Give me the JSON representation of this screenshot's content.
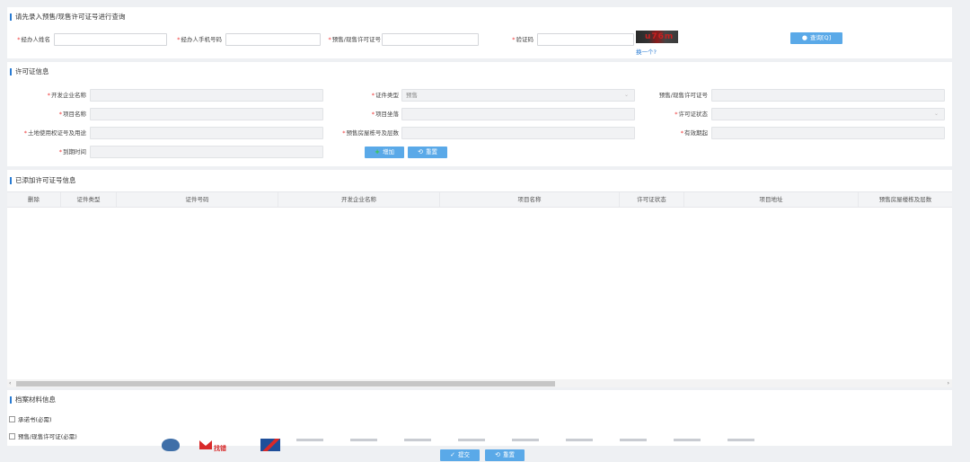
{
  "query": {
    "title": "请先录入预售/现售许可证号进行查询",
    "name_label": "经办人姓名",
    "phone_label": "经办人手机号码",
    "license_label": "预售/现售许可证号",
    "captcha_label": "验证码",
    "captcha_text": "u76m",
    "refresh_link": "换一个?",
    "search_button": "查询[Q]"
  },
  "license_info": {
    "title": "许可证信息",
    "developer_label": "开发企业名称",
    "cert_type_label": "证件类型",
    "cert_type_value": "预售",
    "presale_no_label": "预售/现售许可证号",
    "project_name_label": "项目名称",
    "project_location_label": "项目坐落",
    "license_status_label": "许可证状态",
    "land_use_label": "土地使用权证号及用途",
    "building_floors_label": "预售房屋栋号及层数",
    "valid_from_label": "有效期起",
    "expiry_label": "到期时间",
    "add_button": "增加",
    "reset_button": "重置"
  },
  "added": {
    "title": "已添加许可证号信息",
    "columns": [
      "删除",
      "证件类型",
      "证件号码",
      "开发企业名称",
      "项目名称",
      "许可证状态",
      "项目地址",
      "预售房屋楼栋及层数"
    ]
  },
  "archive": {
    "title": "档案材料信息",
    "items": [
      "承诺书(必需)",
      "预售/现售许可证(必需)"
    ]
  },
  "footer": {
    "submit_button": "提交",
    "reset_button": "重置",
    "logo_text": "找错"
  },
  "colors": {
    "accent": "#2b7cd3",
    "button": "#5aa9e8",
    "required": "#e33"
  }
}
